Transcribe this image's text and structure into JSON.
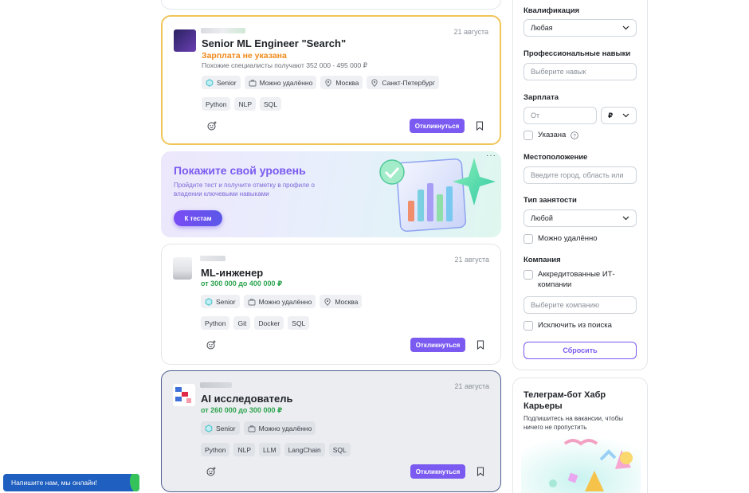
{
  "vacancies": [
    {
      "title": "Senior ML Engineer \"Search\"",
      "date": "21 августа",
      "salary": "Зарплата не указана",
      "similar": "Похожие специалисты получают 352 000 - 495 000 ₽",
      "tags": [
        "Senior",
        "Можно удалённо",
        "Москва",
        "Санкт-Петербург"
      ],
      "skills": [
        "Python",
        "NLP",
        "SQL"
      ],
      "apply_label": "Откликнуться"
    },
    {
      "title": "ML-инженер",
      "date": "21 августа",
      "salary": "от 300 000 до 400 000 ₽",
      "tags": [
        "Senior",
        "Можно удалённо",
        "Москва"
      ],
      "skills": [
        "Python",
        "Git",
        "Docker",
        "SQL"
      ],
      "apply_label": "Откликнуться"
    },
    {
      "title": "AI исследователь",
      "date": "21 августа",
      "salary": "от 260 000 до 300 000 ₽",
      "tags": [
        "Senior",
        "Можно удалённо"
      ],
      "skills": [
        "Python",
        "NLP",
        "LLM",
        "LangChain",
        "SQL"
      ],
      "apply_label": "Откликнуться"
    }
  ],
  "banner": {
    "title": "Покажите свой уровень",
    "subtitle": "Пройдите тест и получите отметку в профиле о владении ключевыми навыками",
    "button": "К тестам",
    "more": "···"
  },
  "filters": {
    "qualification_label": "Квалификация",
    "qualification_value": "Любая",
    "skills_label": "Профессиональные навыки",
    "skills_placeholder": "Выберите навык",
    "salary_label": "Зарплата",
    "salary_placeholder": "От",
    "currency": "₽",
    "salary_specified": "Указана",
    "location_label": "Местоположение",
    "location_placeholder": "Введите город, область или",
    "employment_label": "Тип занятости",
    "employment_value": "Любой",
    "remote": "Можно удалённо",
    "company_label": "Компания",
    "accredited": "Аккредитованные ИТ-компании",
    "company_placeholder": "Выберите компанию",
    "exclude": "Исключить из поиска",
    "reset": "Сбросить"
  },
  "telegram": {
    "title": "Телеграм-бот Хабр Карьеры",
    "subtitle": "Подпишитесь на вакансии, чтобы ничего не пропустить"
  },
  "chat": {
    "label": "Напишите нам, мы онлайн!"
  },
  "colors": {
    "accent": "#7a5af0",
    "salary_green": "#2ea44f",
    "salary_orange": "#f08a1c",
    "highlight_border": "#f0c55a"
  }
}
